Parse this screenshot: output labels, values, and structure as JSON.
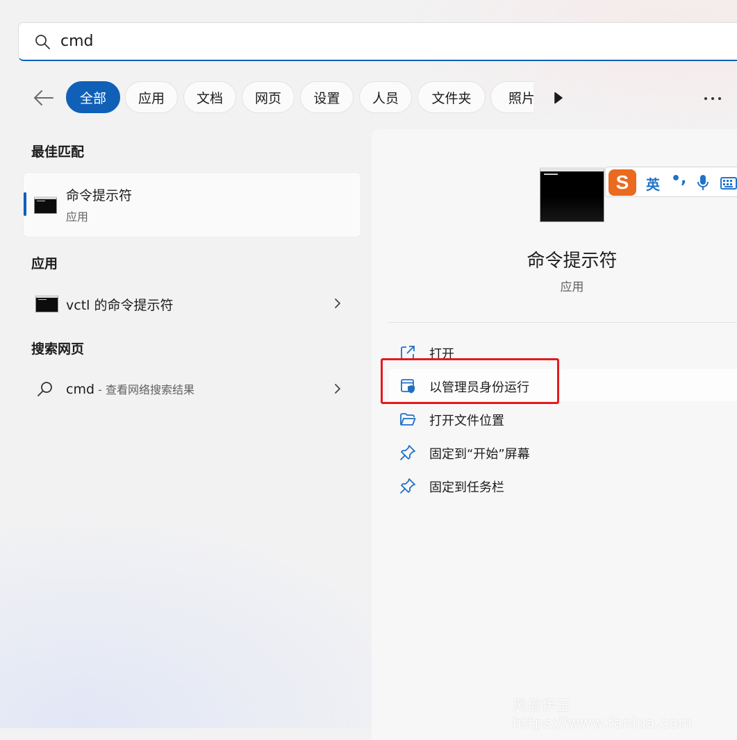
{
  "search": {
    "value": "cmd"
  },
  "filters": [
    {
      "label": "全部",
      "active": true
    },
    {
      "label": "应用"
    },
    {
      "label": "文档"
    },
    {
      "label": "网页"
    },
    {
      "label": "设置"
    },
    {
      "label": "人员"
    },
    {
      "label": "文件夹"
    },
    {
      "label": "照片"
    }
  ],
  "left": {
    "best_match_heading": "最佳匹配",
    "best_match": {
      "title": "命令提示符",
      "subtitle": "应用"
    },
    "apps_heading": "应用",
    "apps": [
      {
        "label": "vctl 的命令提示符"
      }
    ],
    "web_heading": "搜索网页",
    "web": {
      "query": "cmd",
      "desc": " - 查看网络搜索结果"
    }
  },
  "detail": {
    "title": "命令提示符",
    "kind": "应用",
    "actions": [
      {
        "label": "打开",
        "icon": "open-external-icon"
      },
      {
        "label": "以管理员身份运行",
        "icon": "shield-icon"
      },
      {
        "label": "打开文件位置",
        "icon": "folder-icon"
      },
      {
        "label": "固定到“开始”屏幕",
        "icon": "pin-icon"
      },
      {
        "label": "固定到任务栏",
        "icon": "pin-icon"
      }
    ]
  },
  "ime": {
    "logo": "S",
    "lang": "英",
    "punct": "•,"
  },
  "watermark": "风信伊王 https://www.fanlua.com",
  "colors": {
    "accent": "#1060b8",
    "highlight": "#e5191e",
    "ime_orange": "#ea6a1f"
  }
}
